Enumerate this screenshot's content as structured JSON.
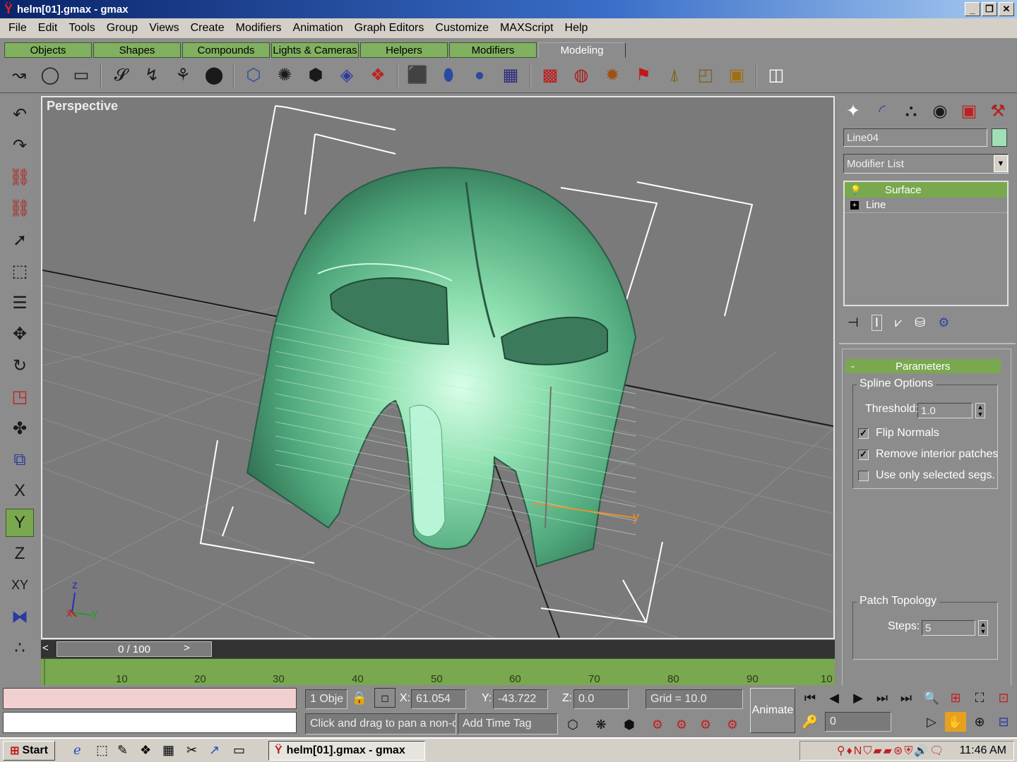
{
  "window": {
    "title": "helm[01].gmax - gmax",
    "logo_glyph": "Ÿ",
    "buttons": [
      "_",
      "❐",
      "✕"
    ]
  },
  "menu": [
    "File",
    "Edit",
    "Tools",
    "Group",
    "Views",
    "Create",
    "Modifiers",
    "Animation",
    "Graph Editors",
    "Customize",
    "MAXScript",
    "Help"
  ],
  "tabs": [
    {
      "label": "Objects"
    },
    {
      "label": "Shapes"
    },
    {
      "label": "Compounds"
    },
    {
      "label": "Lights & Cameras"
    },
    {
      "label": "Helpers"
    },
    {
      "label": "Modifiers"
    },
    {
      "label": "Modeling",
      "active": true
    }
  ],
  "toolbar": {
    "icons": [
      "line-icon",
      "circle-icon",
      "rectangle-icon",
      "text-spline-icon",
      "loft-icon",
      "lathe-icon",
      "extrude-icon",
      "cylinder-outline-icon",
      "sphere-wire-icon",
      "box-wire-icon",
      "grid-icon",
      "patch-icon",
      "cube-icon",
      "tube-icon",
      "sphere-icon",
      "plane-grid-icon",
      "mesh-red-icon",
      "globe-icon",
      "noise-icon",
      "bend-icon",
      "taper-icon",
      "shell-icon",
      "boxmap-icon",
      "uvw-icon"
    ],
    "glyphs": [
      "↝",
      "◯",
      "▭",
      "𝓢",
      "↯",
      "⚘",
      "⬤",
      "⬡",
      "✺",
      "⬢",
      "◈",
      "❖",
      "⬛",
      "⬮",
      "●",
      "▦",
      "▩",
      "◍",
      "✹",
      "⚑",
      "⍋",
      "◰",
      "▣",
      "◫"
    ]
  },
  "left_toolbar": {
    "icons": [
      "undo-icon",
      "redo-icon",
      "link-icon",
      "unlink-icon",
      "select-icon",
      "select-region-icon",
      "select-by-name-icon",
      "move-icon",
      "rotate-icon",
      "scale-icon",
      "pivot-icon",
      "mirror-icon",
      "axis-x-icon",
      "axis-y-icon",
      "axis-z-icon",
      "axis-xy-icon",
      "align-icon",
      "snap-icon"
    ],
    "glyphs": [
      "↶",
      "↷",
      "⛓",
      "⛓",
      "➚",
      "⬚",
      "☰",
      "✥",
      "↻",
      "◳",
      "✤",
      "⧉",
      "X",
      "Y",
      "Z",
      "XY",
      "⧓",
      "∴"
    ],
    "active": "Y"
  },
  "viewport": {
    "label": "Perspective",
    "axis_labels": {
      "x": "x",
      "y": "y",
      "z": "z"
    },
    "gizmo_label": "y"
  },
  "timeline": {
    "frame_readout": "0 / 100",
    "prev": "<",
    "next": ">",
    "ticks": [
      "10",
      "20",
      "30",
      "40",
      "50",
      "60",
      "70",
      "80",
      "90",
      "10"
    ]
  },
  "command_panel": {
    "tab_icons": [
      "create-icon",
      "modify-icon",
      "hierarchy-icon",
      "motion-icon",
      "display-icon",
      "utilities-icon"
    ],
    "tab_glyphs": [
      "✦",
      "◜",
      "⛬",
      "◉",
      "▣",
      "⚒"
    ],
    "object_name": "Line04",
    "object_color": "#9fe0b8",
    "modifier_list_placeholder": "Modifier List",
    "dropdown_glyph": "▼",
    "stack": [
      {
        "icon": "bulb-icon",
        "glyph": "💡",
        "label": "Surface",
        "selected": true
      },
      {
        "icon": "expand-icon",
        "glyph": "+",
        "label": "Line",
        "selected": false
      }
    ],
    "stack_tool_icons": [
      "pin-stack-icon",
      "show-end-result-icon",
      "make-unique-icon",
      "remove-modifier-icon",
      "configure-sets-icon"
    ],
    "stack_tool_glyphs": [
      "⊣",
      "Ⅰ",
      "⩗",
      "⛁",
      "⚙"
    ],
    "rollout": {
      "toggle": "-",
      "title": "Parameters",
      "spline_options_label": "Spline Options",
      "threshold_label": "Threshold:",
      "threshold_value": "1.0",
      "checkboxes": [
        {
          "label": "Flip Normals",
          "checked": true
        },
        {
          "label": "Remove interior patches",
          "checked": true
        },
        {
          "label": "Use only selected segs.",
          "checked": false
        }
      ],
      "patch_topology_label": "Patch Topology",
      "steps_label": "Steps:",
      "steps_value": "5"
    }
  },
  "status": {
    "selection_count": "1 Obje",
    "lock_glyph": "🔒",
    "x_label": "X:",
    "x_value": "61.054",
    "y_label": "Y:",
    "y_value": "-43.722",
    "z_label": "Z:",
    "z_value": "0.0",
    "grid": "Grid = 10.0",
    "prompt": "Click and drag to pan a non-ca",
    "time_tag": "Add Time Tag",
    "animate": "Animate",
    "frame_value": "0",
    "key_glyph": "🔑"
  },
  "playback_glyphs": [
    "⏮",
    "◀",
    "▶",
    "⏭",
    "⏭"
  ],
  "nav_glyphs": [
    "🔍",
    "⊞",
    "⛶",
    "⊡",
    "▷",
    "✋",
    "⊕",
    "⊟"
  ],
  "snap_glyphs": [
    "⬡",
    "❋",
    "⬢",
    "⚙",
    "⚙",
    "⚙",
    "⚙"
  ],
  "taskbar": {
    "start": "Start",
    "item": "helm[01].gmax - gmax",
    "clock": "11:46 AM",
    "quick_launch_glyphs": [
      "ℯ",
      "⬚",
      "✎",
      "❖",
      "▦",
      "✂",
      "↗",
      "▭"
    ],
    "tray_glyphs": "⚲♦N⛉▰▰⊛⛨🔊🗨"
  },
  "colors": {
    "accent_green": "#7aa84e",
    "helmet": "#6fcf9f"
  }
}
